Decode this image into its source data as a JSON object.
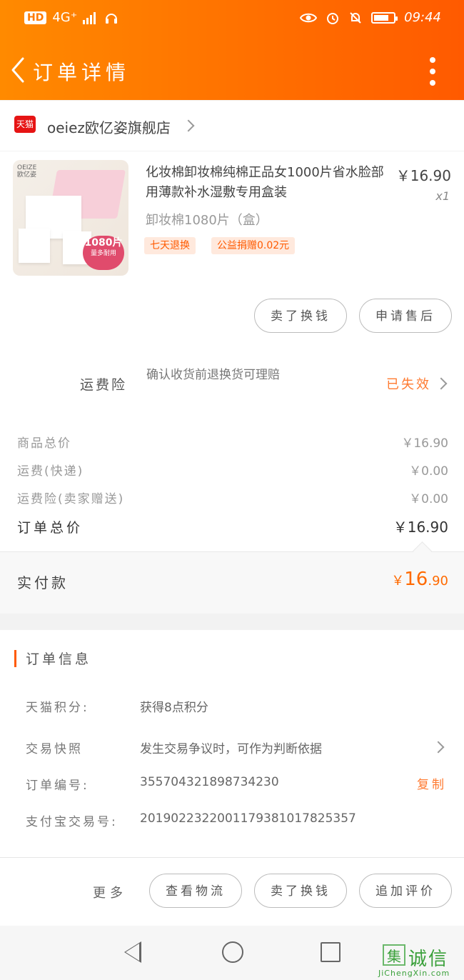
{
  "status_bar": {
    "network": "HD",
    "signal": "4G⁺",
    "time": "09:44",
    "battery": "77",
    "battery_level": 0.77
  },
  "nav": {
    "title": "订单详情",
    "back_icon": "chevron-left-icon",
    "more_icon": "more-vertical-icon"
  },
  "shop": {
    "badge": "天猫",
    "name": "oeiez欧亿姿旗舰店"
  },
  "product": {
    "image_brand": "OEIZE\n欧亿姿",
    "image_badge_number": "1080片",
    "image_badge_text": "量多耐用",
    "title": "化妆棉卸妆棉纯棉正品女1000片省水脸部用薄款补水湿敷专用盒装",
    "price": "￥16.90",
    "quantity": "x1",
    "sku": "卸妆棉1080片（盒）",
    "tags": [
      "七天退换",
      "公益捐赠0.02元"
    ],
    "buttons": [
      "卖了换钱",
      "申请售后"
    ]
  },
  "insurance": {
    "label": "运费险",
    "description": "确认收货前退换货可理赔",
    "status": "已失效"
  },
  "prices": {
    "rows": [
      {
        "label": "商品总价",
        "value": "￥16.90"
      },
      {
        "label": "运费(快递)",
        "value": "￥0.00"
      },
      {
        "label": "运费险(卖家赠送)",
        "value": "￥0.00"
      }
    ],
    "total_label": "订单总价",
    "total_value": "￥16.90"
  },
  "paid": {
    "label": "实付款",
    "currency": "￥",
    "integer": "16",
    "decimal": ".90"
  },
  "order_info": {
    "title": "订单信息",
    "rows": [
      {
        "label": "天猫积分:",
        "value": "获得8点积分"
      },
      {
        "label": "交易快照",
        "value": "发生交易争议时，可作为判断依据"
      },
      {
        "label": "订单编号:",
        "value": "355704321898734230"
      },
      {
        "label": "支付宝交易号:",
        "value": "2019022322001179381017825357"
      }
    ],
    "copy_label": "复制"
  },
  "bottom_bar": {
    "more_label": "更多",
    "buttons": [
      "查看物流",
      "卖了换钱",
      "追加评价"
    ]
  },
  "watermark": {
    "box": "集",
    "text": "诚信",
    "url": "JiChengXin.com"
  },
  "colors": {
    "header_start": "#ff8a00",
    "header_end": "#ff5a00",
    "accent": "#ff6a00"
  }
}
